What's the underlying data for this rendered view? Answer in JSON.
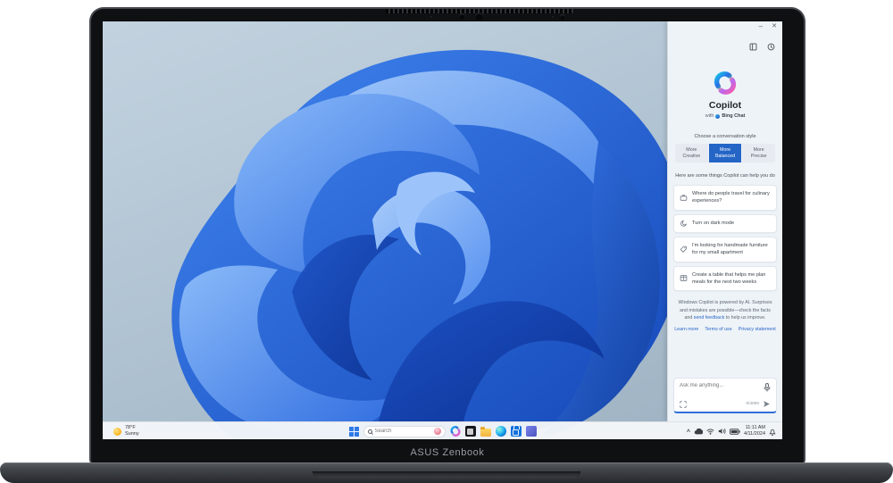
{
  "laptop": {
    "brand": "ASUS Zenbook"
  },
  "copilot": {
    "controls": {
      "minimize": "–",
      "close": "✕"
    },
    "title": "Copilot",
    "subtitle": {
      "prefix": "with",
      "brand": "Bing Chat"
    },
    "style_prompt": "Choose a conversation style",
    "styles": [
      {
        "label": "More Creative",
        "selected": false
      },
      {
        "label": "More Balanced",
        "selected": true
      },
      {
        "label": "More Precise",
        "selected": false
      }
    ],
    "helper": "Here are some things Copilot can help you do",
    "suggestions": [
      {
        "icon": "briefcase-icon",
        "text": "Where do people travel for culinary experiences?"
      },
      {
        "icon": "moon-icon",
        "text": "Turn on dark mode"
      },
      {
        "icon": "tag-icon",
        "text": "I'm looking for handmade furniture for my small apartment"
      },
      {
        "icon": "table-icon",
        "text": "Create a table that helps me plan meals for the next two weeks"
      }
    ],
    "disclaimer": {
      "pre": "Windows Copilot is powered by AI. Surprises and mistakes are possible—check the facts and ",
      "link": "send feedback",
      "post": " to help us improve."
    },
    "footer_links": [
      "Learn more",
      "Terms of use",
      "Privacy statement"
    ],
    "input": {
      "placeholder": "Ask me anything...",
      "counter": "0/4000"
    }
  },
  "taskbar": {
    "weather": {
      "temperature": "78°F",
      "condition": "Sunny"
    },
    "search_placeholder": "Search",
    "clock": {
      "time": "11:11 AM",
      "date": "4/11/2024"
    }
  },
  "colors": {
    "accent_blue": "#2465c6",
    "link_blue": "#2a66c8",
    "bloom_blue": "#2b6fe3",
    "wallpaper_top": "#c3d2df"
  }
}
